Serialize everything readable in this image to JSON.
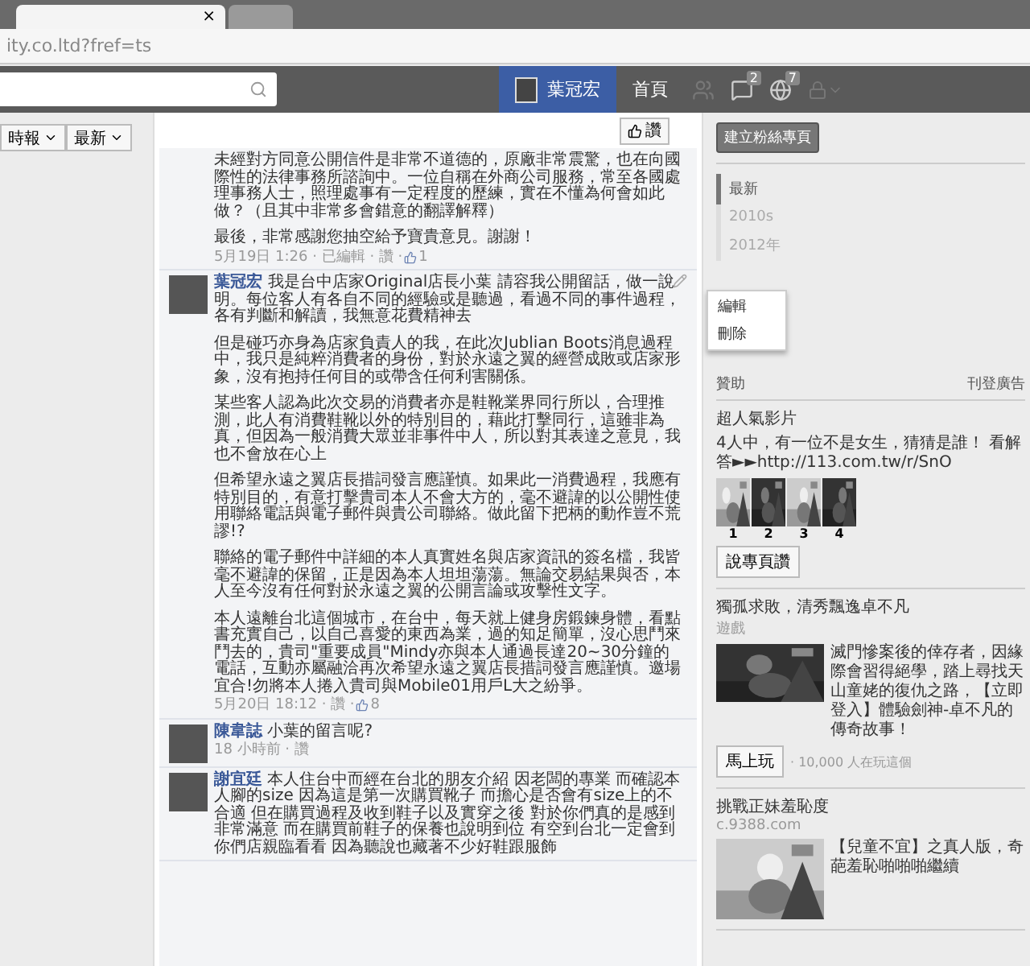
{
  "browser": {
    "tabs": [
      {
        "label": "×",
        "selected": true
      },
      {
        "selected": false
      }
    ],
    "address": "ity.co.ltd?fref=ts"
  },
  "topbar": {
    "nav": [
      {
        "label": "葉冠宏",
        "selected": true,
        "kind": "profile"
      },
      {
        "label": "首頁",
        "selected": false,
        "kind": "link"
      }
    ],
    "badges": [
      {
        "kind": "messages",
        "count": "2"
      },
      {
        "kind": "notifications",
        "count": "7"
      }
    ]
  },
  "filters": [
    "時報",
    "最新"
  ],
  "like_button": "讚",
  "comments": [
    {
      "paragraphs": [
        "未經對方同意公開信件是非常不道德的，原廠非常震驚，也在向國際性的法律事務所諮詢中。一位自稱在外商公司服務，常至各國處理事務人士，照理處事有一定程度的歷練，實在不懂為何會如此做？（且其中非常多會錯意的翻譯解釋）",
        "最後，非常感謝您抽空給予寶貴意見。謝謝！"
      ],
      "meta": "5月19日 1:26 · 已編輯 · 讚 · ",
      "likes": "1"
    },
    {
      "author": "葉冠宏",
      "lead": "我是台中店家Original店長小葉",
      "paragraphs": [
        "請容我公開留話，做一說明。每位客人有各自不同的經驗或是聽過，看過不同的事件過程，各有判斷和解讀，我無意花費精神去",
        "但是碰巧亦身為店家負責人的我，在此次Jublian Boots消息過程中，我只是純粹消費者的身份，對於永遠之翼的經營成敗或店家形象，沒有抱持任何目的或帶含任何利害關係。",
        "某些客人認為此次交易的消費者亦是鞋靴業界同行所以，合理推測，此人有消費鞋靴以外的特別目的，藉此打擊同行，這雖非為真，但因為一般消費大眾並非事件中人，所以對其表達之意見，我也不會放在心上",
        "但希望永遠之翼店長措詞發言應謹慎。如果此一消費過程，我應有特別目的，有意打擊貴司本人不會大方的，毫不避諱的以公開性使用聯絡電話與電子郵件與貴公司聯絡。做此留下把柄的動作豈不荒謬!?",
        "聯絡的電子郵件中詳細的本人真實姓名與店家資訊的簽名檔，我皆毫不避諱的保留，正是因為本人坦坦蕩蕩。無論交易結果與否，本人至今沒有任何對於永遠之翼的公開言論或攻擊性文字。",
        "本人遠離台北這個城市，在台中，每天就上健身房鍛鍊身體，看點書充實自己，以自己喜愛的東西為業，過的知足簡單，沒心思鬥來鬥去的，貴司\"重要成員\"Mindy亦與本人通過長達20~30分鐘的電話，互動亦屬融洽再次希望永遠之翼店長措詞發言應謹慎。邀場宜合!勿將本人捲入貴司與Mobile01用戶L大之紛爭。"
      ],
      "meta": "5月20日 18:12 · 讚 · ",
      "likes": "8",
      "menu": [
        "編輯",
        "刪除"
      ]
    }
  ],
  "replies": [
    {
      "author": "陳韋誌",
      "text": "小葉的留言呢?",
      "meta": "18 小時前 · 讚"
    },
    {
      "author": "謝宜廷",
      "text": "本人住台中而經在台北的朋友介紹 因老闆的專業 而確認本人腳的size 因為這是第一次購買靴子 而擔心是否會有size上的不合適 但在購買過程及收到鞋子以及實穿之後 對於你們真的是感到非常滿意 而在購買前鞋子的保養也說明到位 有空到台北一定會到你們店親臨看看 因為聽說也藏著不少好鞋跟服飾"
    }
  ],
  "sidebar": {
    "create_page": "建立粉絲專頁",
    "timeline": [
      {
        "label": "最新",
        "selected": true
      },
      {
        "label": "2010s",
        "selected": false
      },
      {
        "label": "2012年",
        "selected": false
      }
    ],
    "sponsored": "贊助",
    "create_ad": "刊登廣告",
    "ads": [
      {
        "title": "超人氣影片",
        "body": "4人中，有一位不是女生，猜猜是誰！ 看解答►►http://113.com.tw/r/SnO",
        "kind": "gallery",
        "thumbs": [
          "1",
          "2",
          "3",
          "4"
        ],
        "button": "說專頁讚"
      },
      {
        "title": "獨孤求敗，清秀飄逸卓不凡",
        "source": "遊戲",
        "body": "滅門慘案後的倖存者，因緣際會習得絕學，踏上尋找天山童姥的復仇之路，【立即登入】體驗劍神-卓不凡的傳奇故事！",
        "kind": "side",
        "button": "馬上玩",
        "note": "· 10,000 人在玩這個"
      },
      {
        "title": "挑戰正妹羞恥度",
        "source": "c.9388.com",
        "body": "【兒童不宜】之真人版，奇葩羞恥啪啪啪繼續",
        "kind": "side"
      }
    ]
  }
}
